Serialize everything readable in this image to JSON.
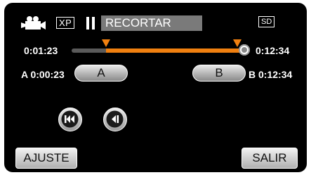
{
  "status": {
    "quality": "XP",
    "mode_title": "RECORTAR",
    "media": "SD",
    "camera_icon": "video-camera-icon",
    "pause_icon": "pause-icon"
  },
  "timeline": {
    "start_time": "0:01:23",
    "end_time": "0:12:34",
    "range_start_fraction": 0.2,
    "range_end_fraction": 1.0,
    "accent": "#f08010"
  },
  "points": {
    "a_prefix": "A",
    "a_time": "0:00:23",
    "a_button": "A",
    "b_prefix": "B",
    "b_time": "0:12:34",
    "b_button": "B"
  },
  "controls": {
    "prev_icon": "skip-to-start-icon",
    "step_back_icon": "frame-step-back-icon"
  },
  "footer": {
    "ajuste": "AJUSTE",
    "salir": "SALIR"
  }
}
